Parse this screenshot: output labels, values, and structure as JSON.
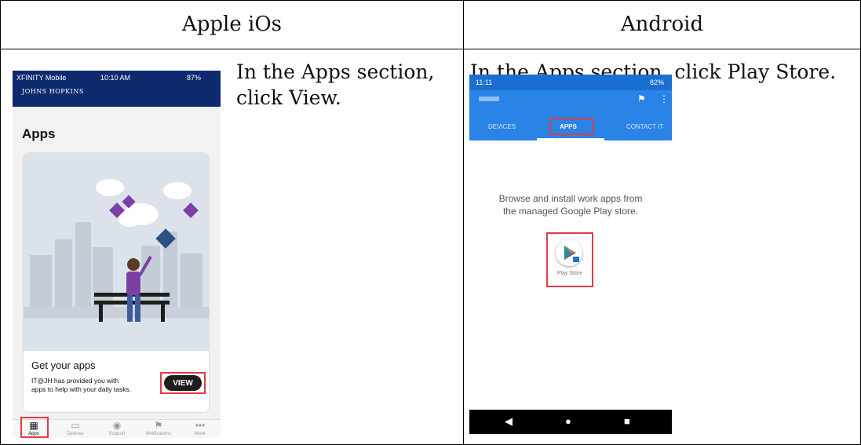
{
  "table": {
    "header_ios": "Apple iOs",
    "header_android": "Android",
    "instruction_ios_line1": "In the Apps section,",
    "instruction_ios_line2": "click View.",
    "instruction_android": "In the Apps section, click Play Store."
  },
  "ios": {
    "status_carrier": "XFINITY Mobile",
    "status_time": "10:10 AM",
    "status_battery": "87%",
    "brand": "JOHNS HOPKINS",
    "brand_sub": "",
    "page_title": "Apps",
    "card_title": "Get your apps",
    "card_desc_line1": "IT@JH has provided you with",
    "card_desc_line2": "apps to help with your daily tasks.",
    "view_button": "VIEW",
    "tabs": [
      "Apps",
      "Devices",
      "Support",
      "Notifications",
      "More"
    ],
    "tab_icons": [
      "grid-icon",
      "devices-icon",
      "support-icon",
      "flag-icon",
      "more-icon"
    ]
  },
  "android": {
    "status_time": "11:11",
    "status_battery": "82%",
    "tabs": [
      "DEVICES",
      "APPS",
      "CONTACT IT"
    ],
    "message_line1": "Browse and install work apps from",
    "message_line2": "the managed Google Play store.",
    "play_store_label": "Play Store"
  },
  "colors": {
    "highlight": "#e03c46",
    "ios_header": "#0e2a6e",
    "android_bar": "#2a83e6"
  }
}
